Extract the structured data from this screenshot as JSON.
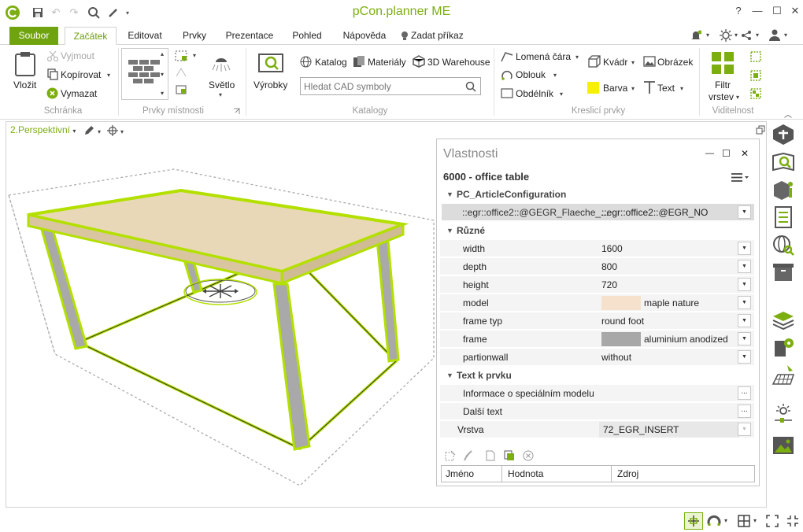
{
  "app": {
    "title": "pCon.planner ME"
  },
  "titlebar": {
    "help": "?"
  },
  "tabs": [
    {
      "label": "Soubor"
    },
    {
      "label": "Začátek"
    },
    {
      "label": "Editovat"
    },
    {
      "label": "Prvky"
    },
    {
      "label": "Prezentace"
    },
    {
      "label": "Pohled"
    },
    {
      "label": "Nápověda"
    },
    {
      "label": "Zadat příkaz"
    }
  ],
  "ribbon": {
    "schranka": {
      "paste": "Vložit",
      "cut": "Vyjmout",
      "copy": "Kopírovat",
      "delete": "Vymazat",
      "group": "Schránka"
    },
    "prvky": {
      "light": "Světlo",
      "group": "Prvky místnosti"
    },
    "katalogy": {
      "products": "Výrobky",
      "catalog": "Katalog",
      "materials": "Materiály",
      "warehouse": "3D Warehouse",
      "search_placeholder": "Hledat CAD symboly",
      "group": "Katalogy"
    },
    "kreslici": {
      "polyline": "Lomená čára",
      "arc": "Oblouk",
      "rect": "Obdélník",
      "box": "Kvádr",
      "image": "Obrázek",
      "color": "Barva",
      "text": "Text",
      "group": "Kreslicí prvky"
    },
    "viditelnost": {
      "filter1": "Filtr",
      "filter2": "vrstev",
      "group": "Viditelnost"
    }
  },
  "viewport": {
    "label": "2.Perspektivní"
  },
  "properties": {
    "title": "Vlastnosti",
    "article": "6000 - office table",
    "sections": {
      "config": "PC_ArticleConfiguration",
      "misc": "Různé",
      "text": "Text k prvku"
    },
    "config_row": {
      "key": "::egr::office2::@GEGR_Flaeche_...",
      "value": "::egr::office2::@EGR_NO"
    },
    "rows": [
      {
        "key": "width",
        "value": "1600"
      },
      {
        "key": "depth",
        "value": "800"
      },
      {
        "key": "height",
        "value": "720"
      },
      {
        "key": "model",
        "value": "maple nature",
        "swatch": "#f6e2cc"
      },
      {
        "key": "frame typ",
        "value": "round foot"
      },
      {
        "key": "frame",
        "value": "aluminium anodized",
        "swatch": "#a8a8a8"
      },
      {
        "key": "partionwall",
        "value": "without"
      }
    ],
    "text_rows": [
      {
        "key": "Informace o speciálním modelu",
        "value": "..."
      },
      {
        "key": "Další text",
        "value": "..."
      }
    ],
    "layer": {
      "key": "Vrstva",
      "value": "72_EGR_INSERT"
    },
    "table_headers": [
      "Jméno",
      "Hodnota",
      "Zdroj"
    ]
  },
  "colors": {
    "accent": "#7cae10",
    "selection": "#b3e000",
    "soubor": "#70a40f"
  }
}
